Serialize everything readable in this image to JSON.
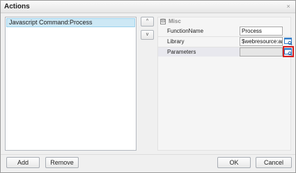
{
  "window": {
    "title": "Actions",
    "close_label": "⨯"
  },
  "actions_list": {
    "items": [
      {
        "label": "Javascript Command:Process",
        "selected": true
      }
    ]
  },
  "reorder": {
    "up_label": "^",
    "down_label": "v"
  },
  "property_grid": {
    "category": {
      "toggle": "⊟",
      "label": "Misc"
    },
    "rows": [
      {
        "name": "FunctionName",
        "value": "Process",
        "has_lookup": false
      },
      {
        "name": "Library",
        "value": "$webresource:ar",
        "has_lookup": true
      },
      {
        "name": "Parameters",
        "value": "",
        "has_lookup": true,
        "lookup_highlighted": true
      }
    ]
  },
  "buttons": {
    "add": "Add",
    "remove": "Remove",
    "ok": "OK",
    "cancel": "Cancel"
  },
  "colors": {
    "selection_bg": "#cde8f5",
    "highlight": "#d82020",
    "lookup_icon": "#2f7cc9"
  }
}
